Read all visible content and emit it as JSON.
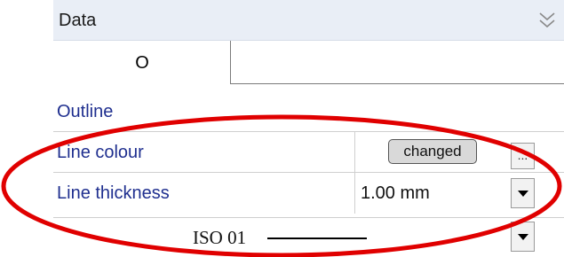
{
  "header": {
    "title": "Data",
    "collapse_icon": "double-chevron-down-icon"
  },
  "tabs": [
    {
      "label": "O",
      "active": true
    }
  ],
  "section": {
    "title": "Outline"
  },
  "properties": [
    {
      "label": "Line colour",
      "value": "changed",
      "button": "..."
    },
    {
      "label": "Line thickness",
      "value": "1.00 mm"
    }
  ],
  "linetype": {
    "label": "ISO 01"
  },
  "annotation": {
    "color": "#e00000",
    "shape": "ellipse"
  }
}
